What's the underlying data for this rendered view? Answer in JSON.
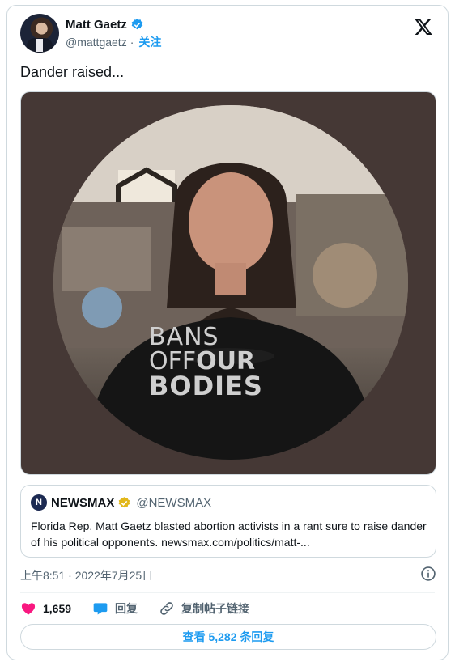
{
  "author": {
    "name": "Matt Gaetz",
    "handle": "@mattgaetz",
    "separator": "·",
    "follow_label": "关注"
  },
  "tweet": {
    "text": "Dander raised..."
  },
  "media": {
    "shirt_lines": [
      "BANS",
      "OFF",
      "OUR",
      "BODIES"
    ]
  },
  "quote": {
    "logo_letter": "N",
    "name": "NEWSMAX",
    "handle": "@NEWSMAX",
    "text": "Florida Rep. Matt Gaetz blasted abortion activists in a rant sure to raise dander of his political opponents.  newsmax.com/politics/matt-..."
  },
  "timestamp": "上午8:51 · 2022年7月25日",
  "actions": {
    "likes": "1,659",
    "reply_label": "回复",
    "copy_link_label": "复制帖子链接"
  },
  "replies_button": "查看 5,282 条回复",
  "colors": {
    "accent": "#1d9bf0",
    "like": "#f91880",
    "gold": "#e2b719",
    "border": "#cfd9de"
  }
}
